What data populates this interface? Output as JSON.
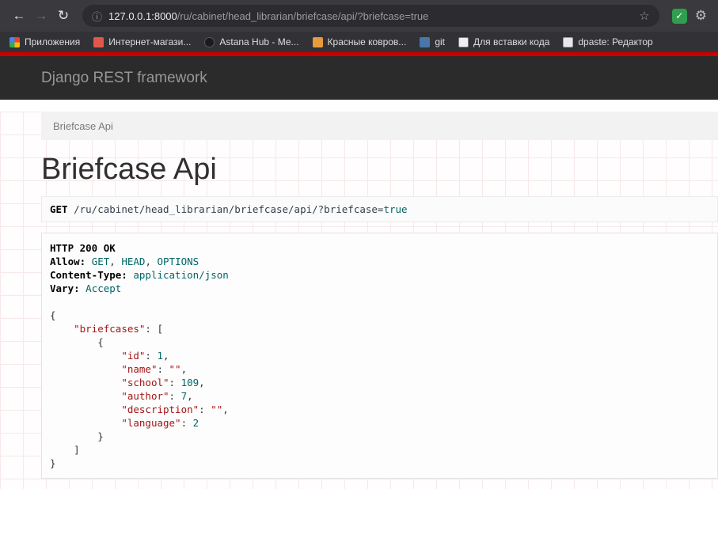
{
  "browser": {
    "address": {
      "host": "127.0.0.1:8000",
      "path": "/ru/cabinet/head_librarian/briefcase/api/?briefcase=true"
    },
    "bookmarks": [
      {
        "label": "Приложения",
        "icon": "apps"
      },
      {
        "label": "Интернет-магази...",
        "icon": "shop"
      },
      {
        "label": "Astana Hub - Ме...",
        "icon": "hub"
      },
      {
        "label": "Красные ковров...",
        "icon": "carpet"
      },
      {
        "label": "git",
        "icon": "vk"
      },
      {
        "label": "Для вставки кода",
        "icon": "code"
      },
      {
        "label": "dpaste: Редактор",
        "icon": "paste"
      }
    ]
  },
  "drf": {
    "brand": "Django REST framework",
    "breadcrumb": "Briefcase Api",
    "title": "Briefcase Api",
    "request_tokens": [
      [
        "m",
        "GET"
      ],
      [
        "p",
        " "
      ],
      [
        "u",
        "/ru/cabinet/head_librarian/briefcase/api/?briefcase="
      ],
      [
        "l",
        "true"
      ]
    ],
    "response_lines": [
      [
        [
          "b",
          "HTTP 200 OK"
        ]
      ],
      [
        [
          "b",
          "Allow:"
        ],
        [
          "p",
          " "
        ],
        [
          "l",
          "GET"
        ],
        [
          "p",
          ", "
        ],
        [
          "l",
          "HEAD"
        ],
        [
          "p",
          ", "
        ],
        [
          "l",
          "OPTIONS"
        ]
      ],
      [
        [
          "b",
          "Content-Type:"
        ],
        [
          "p",
          " "
        ],
        [
          "l",
          "application/json"
        ]
      ],
      [
        [
          "b",
          "Vary:"
        ],
        [
          "p",
          " "
        ],
        [
          "l",
          "Accept"
        ]
      ],
      [
        [
          "p",
          " "
        ]
      ],
      [
        [
          "p",
          "{"
        ]
      ],
      [
        [
          "p",
          "    "
        ],
        [
          "s",
          "\"briefcases\""
        ],
        [
          "p",
          ": ["
        ]
      ],
      [
        [
          "p",
          "        {"
        ]
      ],
      [
        [
          "p",
          "            "
        ],
        [
          "s",
          "\"id\""
        ],
        [
          "p",
          ": "
        ],
        [
          "l",
          "1"
        ],
        [
          "p",
          ","
        ]
      ],
      [
        [
          "p",
          "            "
        ],
        [
          "s",
          "\"name\""
        ],
        [
          "p",
          ": "
        ],
        [
          "s",
          "\"\""
        ],
        [
          "p",
          ","
        ]
      ],
      [
        [
          "p",
          "            "
        ],
        [
          "s",
          "\"school\""
        ],
        [
          "p",
          ": "
        ],
        [
          "l",
          "109"
        ],
        [
          "p",
          ","
        ]
      ],
      [
        [
          "p",
          "            "
        ],
        [
          "s",
          "\"author\""
        ],
        [
          "p",
          ": "
        ],
        [
          "l",
          "7"
        ],
        [
          "p",
          ","
        ]
      ],
      [
        [
          "p",
          "            "
        ],
        [
          "s",
          "\"description\""
        ],
        [
          "p",
          ": "
        ],
        [
          "s",
          "\"\""
        ],
        [
          "p",
          ","
        ]
      ],
      [
        [
          "p",
          "            "
        ],
        [
          "s",
          "\"language\""
        ],
        [
          "p",
          ": "
        ],
        [
          "l",
          "2"
        ]
      ],
      [
        [
          "p",
          "        }"
        ]
      ],
      [
        [
          "p",
          "    ]"
        ]
      ],
      [
        [
          "p",
          "}"
        ]
      ]
    ]
  }
}
